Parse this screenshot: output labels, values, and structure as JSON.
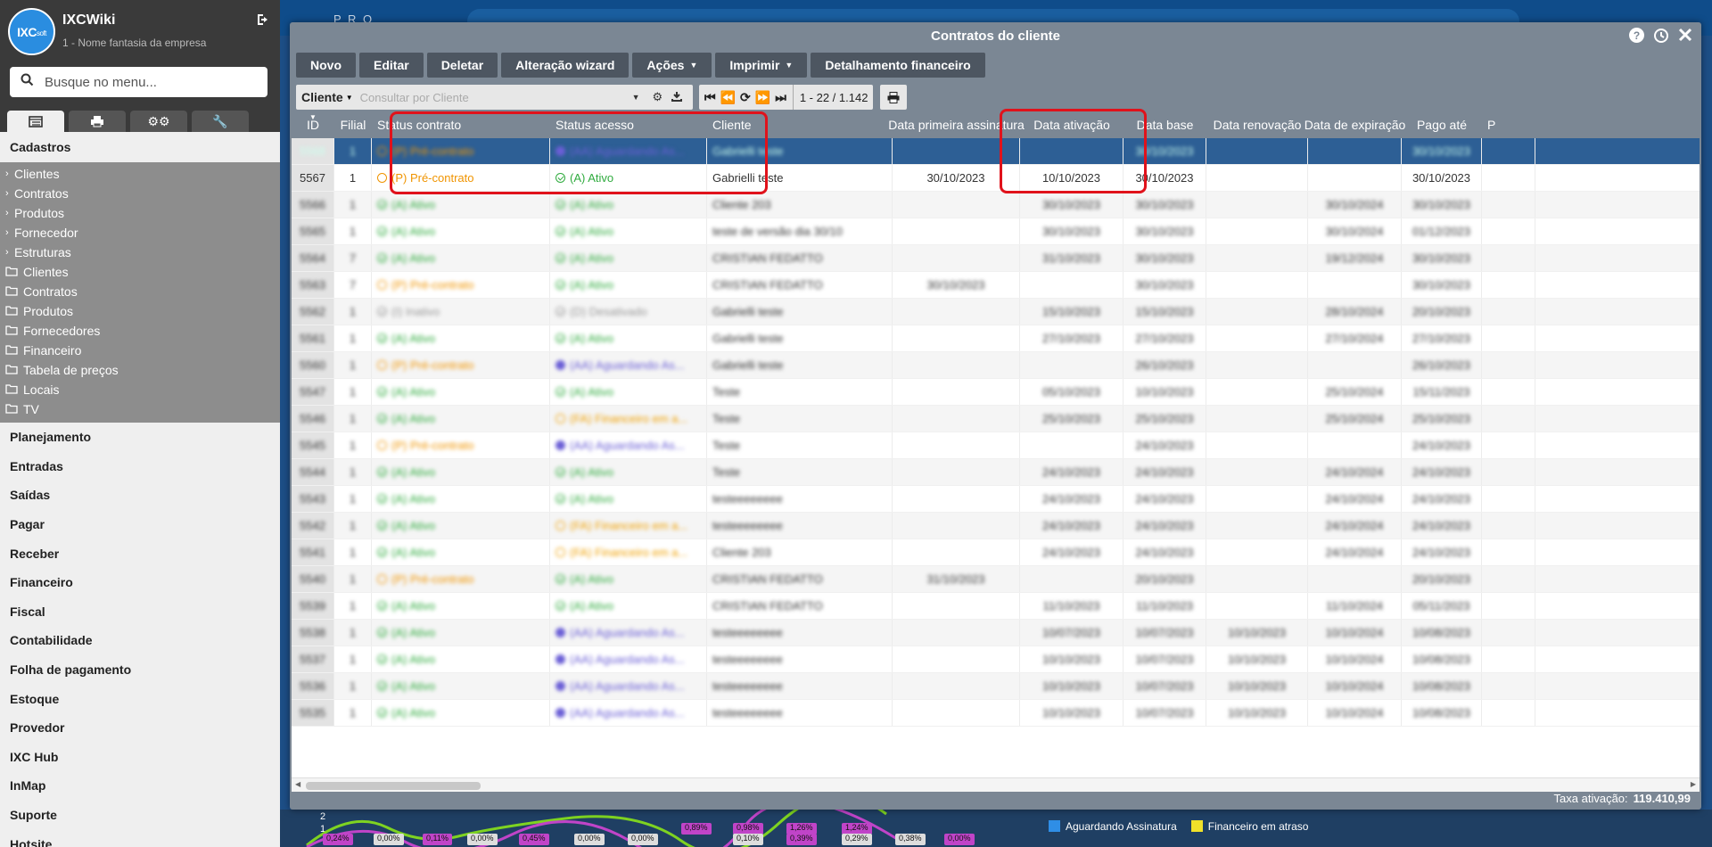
{
  "sidebar": {
    "logo_text": "IXC",
    "logo_sub": "soft",
    "app_name": "IXCWiki",
    "company": "1 - Nome fantasia da empresa",
    "search_placeholder": "Busque no menu...",
    "section_title": "Cadastros",
    "cadastros_groups": [
      "Clientes",
      "Contratos",
      "Produtos",
      "Fornecedor",
      "Estruturas"
    ],
    "cadastros_folders": [
      "Clientes",
      "Contratos",
      "Produtos",
      "Fornecedores",
      "Financeiro",
      "Tabela de preços",
      "Locais",
      "TV"
    ],
    "menu": [
      "Planejamento",
      "Entradas",
      "Saídas",
      "Pagar",
      "Receber",
      "Financeiro",
      "Fiscal",
      "Contabilidade",
      "Folha de pagamento",
      "Estoque",
      "Provedor",
      "IXC Hub",
      "InMap",
      "Suporte",
      "Hotsite"
    ]
  },
  "modal": {
    "title": "Contratos do cliente",
    "toolbar": {
      "novo": "Novo",
      "editar": "Editar",
      "deletar": "Deletar",
      "alteracao": "Alteração wizard",
      "acoes": "Ações",
      "imprimir": "Imprimir",
      "detalhamento": "Detalhamento financeiro"
    },
    "filter": {
      "field": "Cliente",
      "placeholder": "Consultar por Cliente"
    },
    "pager": "1 - 22 / 1.142",
    "columns": [
      "ID",
      "Filial",
      "Status contrato",
      "Status acesso",
      "Cliente",
      "Data primeira assinatura",
      "Data ativação",
      "Data base",
      "Data renovação",
      "Data de expiração",
      "Pago até",
      "P"
    ],
    "rows": [
      {
        "id": "5568",
        "filial": "1",
        "status": "(P) Pré-contrato",
        "st": "pre",
        "acesso": "(AA) Aguardando As...",
        "ac": "aguard",
        "cliente": "Gabrielli teste",
        "assin": "",
        "ativ": "",
        "base": "30/10/2023",
        "renov": "",
        "exp": "",
        "pago": "30/10/2023",
        "blur": true,
        "selected": true
      },
      {
        "id": "5567",
        "filial": "1",
        "status": "(P) Pré-contrato",
        "st": "pre",
        "acesso": "(A) Ativo",
        "ac": "ativo",
        "cliente": "Gabrielli teste",
        "assin": "30/10/2023",
        "ativ": "10/10/2023",
        "base": "30/10/2023",
        "renov": "",
        "exp": "",
        "pago": "30/10/2023",
        "blur": false
      },
      {
        "id": "5566",
        "filial": "1",
        "status": "(A) Ativo",
        "st": "ativo",
        "acesso": "(A) Ativo",
        "ac": "ativo",
        "cliente": "Cliente 203",
        "assin": "",
        "ativ": "30/10/2023",
        "base": "30/10/2023",
        "renov": "",
        "exp": "30/10/2024",
        "pago": "30/10/2023",
        "blur": true
      },
      {
        "id": "5565",
        "filial": "1",
        "status": "(A) Ativo",
        "st": "ativo",
        "acesso": "(A) Ativo",
        "ac": "ativo",
        "cliente": "teste de versão dia 30/10",
        "assin": "",
        "ativ": "30/10/2023",
        "base": "30/10/2023",
        "renov": "",
        "exp": "30/10/2024",
        "pago": "01/12/2023",
        "blur": true
      },
      {
        "id": "5564",
        "filial": "7",
        "status": "(A) Ativo",
        "st": "ativo",
        "acesso": "(A) Ativo",
        "ac": "ativo",
        "cliente": "CRISTIAN FEDATTO",
        "assin": "",
        "ativ": "31/10/2023",
        "base": "30/10/2023",
        "renov": "",
        "exp": "19/12/2024",
        "pago": "30/10/2023",
        "blur": true
      },
      {
        "id": "5563",
        "filial": "7",
        "status": "(P) Pré-contrato",
        "st": "pre",
        "acesso": "(A) Ativo",
        "ac": "ativo",
        "cliente": "CRISTIAN FEDATTO",
        "assin": "30/10/2023",
        "ativ": "",
        "base": "30/10/2023",
        "renov": "",
        "exp": "",
        "pago": "30/10/2023",
        "blur": true
      },
      {
        "id": "5562",
        "filial": "1",
        "status": "(I) Inativo",
        "st": "inat",
        "acesso": "(D) Desativado",
        "ac": "inat",
        "cliente": "Gabrielli teste",
        "assin": "",
        "ativ": "15/10/2023",
        "base": "15/10/2023",
        "renov": "",
        "exp": "28/10/2024",
        "pago": "20/10/2023",
        "blur": true
      },
      {
        "id": "5561",
        "filial": "1",
        "status": "(A) Ativo",
        "st": "ativo",
        "acesso": "(A) Ativo",
        "ac": "ativo",
        "cliente": "Gabrielli teste",
        "assin": "",
        "ativ": "27/10/2023",
        "base": "27/10/2023",
        "renov": "",
        "exp": "27/10/2024",
        "pago": "27/10/2023",
        "blur": true
      },
      {
        "id": "5560",
        "filial": "1",
        "status": "(P) Pré-contrato",
        "st": "pre",
        "acesso": "(AA) Aguardando As...",
        "ac": "aguard",
        "cliente": "Gabrielli teste",
        "assin": "",
        "ativ": "",
        "base": "26/10/2023",
        "renov": "",
        "exp": "",
        "pago": "26/10/2023",
        "blur": true
      },
      {
        "id": "5547",
        "filial": "1",
        "status": "(A) Ativo",
        "st": "ativo",
        "acesso": "(A) Ativo",
        "ac": "ativo",
        "cliente": "Teste",
        "assin": "",
        "ativ": "05/10/2023",
        "base": "10/10/2023",
        "renov": "",
        "exp": "25/10/2024",
        "pago": "15/11/2023",
        "blur": true
      },
      {
        "id": "5546",
        "filial": "1",
        "status": "(A) Ativo",
        "st": "ativo",
        "acesso": "(FA) Financeiro em a...",
        "ac": "fin",
        "cliente": "Teste",
        "assin": "",
        "ativ": "25/10/2023",
        "base": "25/10/2023",
        "renov": "",
        "exp": "25/10/2024",
        "pago": "25/10/2023",
        "blur": true
      },
      {
        "id": "5545",
        "filial": "1",
        "status": "(P) Pré-contrato",
        "st": "pre",
        "acesso": "(AA) Aguardando As...",
        "ac": "aguard",
        "cliente": "Teste",
        "assin": "",
        "ativ": "",
        "base": "24/10/2023",
        "renov": "",
        "exp": "",
        "pago": "24/10/2023",
        "blur": true
      },
      {
        "id": "5544",
        "filial": "1",
        "status": "(A) Ativo",
        "st": "ativo",
        "acesso": "(A) Ativo",
        "ac": "ativo",
        "cliente": "Teste",
        "assin": "",
        "ativ": "24/10/2023",
        "base": "24/10/2023",
        "renov": "",
        "exp": "24/10/2024",
        "pago": "24/10/2023",
        "blur": true
      },
      {
        "id": "5543",
        "filial": "1",
        "status": "(A) Ativo",
        "st": "ativo",
        "acesso": "(A) Ativo",
        "ac": "ativo",
        "cliente": "testeeeeeeee",
        "assin": "",
        "ativ": "24/10/2023",
        "base": "24/10/2023",
        "renov": "",
        "exp": "24/10/2024",
        "pago": "24/10/2023",
        "blur": true
      },
      {
        "id": "5542",
        "filial": "1",
        "status": "(A) Ativo",
        "st": "ativo",
        "acesso": "(FA) Financeiro em a...",
        "ac": "fin",
        "cliente": "testeeeeeeee",
        "assin": "",
        "ativ": "24/10/2023",
        "base": "24/10/2023",
        "renov": "",
        "exp": "24/10/2024",
        "pago": "24/10/2023",
        "blur": true
      },
      {
        "id": "5541",
        "filial": "1",
        "status": "(A) Ativo",
        "st": "ativo",
        "acesso": "(FA) Financeiro em a...",
        "ac": "fin",
        "cliente": "Cliente 203",
        "assin": "",
        "ativ": "24/10/2023",
        "base": "24/10/2023",
        "renov": "",
        "exp": "24/10/2024",
        "pago": "24/10/2023",
        "blur": true
      },
      {
        "id": "5540",
        "filial": "1",
        "status": "(P) Pré-contrato",
        "st": "pre",
        "acesso": "(A) Ativo",
        "ac": "ativo",
        "cliente": "CRISTIAN FEDATTO",
        "assin": "31/10/2023",
        "ativ": "",
        "base": "20/10/2023",
        "renov": "",
        "exp": "",
        "pago": "20/10/2023",
        "blur": true
      },
      {
        "id": "5539",
        "filial": "1",
        "status": "(A) Ativo",
        "st": "ativo",
        "acesso": "(A) Ativo",
        "ac": "ativo",
        "cliente": "CRISTIAN FEDATTO",
        "assin": "",
        "ativ": "11/10/2023",
        "base": "11/10/2023",
        "renov": "",
        "exp": "11/10/2024",
        "pago": "05/11/2023",
        "blur": true
      },
      {
        "id": "5538",
        "filial": "1",
        "status": "(A) Ativo",
        "st": "ativo",
        "acesso": "(AA) Aguardando As...",
        "ac": "aguard",
        "cliente": "testeeeeeeee",
        "assin": "",
        "ativ": "10/07/2023",
        "base": "10/07/2023",
        "renov": "10/10/2023",
        "exp": "10/10/2024",
        "pago": "10/08/2023",
        "blur": true
      },
      {
        "id": "5537",
        "filial": "1",
        "status": "(A) Ativo",
        "st": "ativo",
        "acesso": "(AA) Aguardando As...",
        "ac": "aguard",
        "cliente": "testeeeeeeee",
        "assin": "",
        "ativ": "10/10/2023",
        "base": "10/07/2023",
        "renov": "10/10/2023",
        "exp": "10/10/2024",
        "pago": "10/08/2023",
        "blur": true
      },
      {
        "id": "5536",
        "filial": "1",
        "status": "(A) Ativo",
        "st": "ativo",
        "acesso": "(AA) Aguardando As...",
        "ac": "aguard",
        "cliente": "testeeeeeeee",
        "assin": "",
        "ativ": "10/10/2023",
        "base": "10/07/2023",
        "renov": "10/10/2023",
        "exp": "10/10/2024",
        "pago": "10/08/2023",
        "blur": true
      },
      {
        "id": "5535",
        "filial": "1",
        "status": "(A) Ativo",
        "st": "ativo",
        "acesso": "(AA) Aguardando As...",
        "ac": "aguard",
        "cliente": "testeeeeeeee",
        "assin": "",
        "ativ": "10/10/2023",
        "base": "10/07/2023",
        "renov": "10/10/2023",
        "exp": "10/10/2024",
        "pago": "10/08/2023",
        "blur": true
      }
    ],
    "footer_label": "Taxa ativação:",
    "footer_value": "119.410,99"
  },
  "background": {
    "brand_fragment": "P R O",
    "legend": [
      "Aguardando Assinatura",
      "Financeiro em atraso"
    ],
    "legend_colors": [
      "#2f8ee6",
      "#f1e12a"
    ],
    "tags": [
      "0,24%",
      "0,00%",
      "0,11%",
      "0,00%",
      "0,45%",
      "0,00%",
      "0,00%",
      "0,89%",
      "0,98%",
      "1,26%",
      "1,24%",
      "0,10%",
      "0,39%",
      "0,29%",
      "0,38%",
      "0,00%"
    ],
    "axis": [
      "2",
      "1"
    ]
  },
  "colors": {
    "sidebar_header": "#3a3a3a",
    "modal": "#7b8794",
    "ativo": "#2fab3e",
    "pre": "#f09400",
    "aguard": "#6b5fd6",
    "highlight": "#e0121b"
  }
}
